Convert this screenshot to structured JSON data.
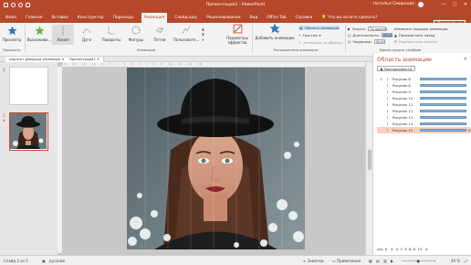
{
  "title_bar": {
    "title": "Презентация1 - PowerPoint",
    "user": "Наталья Смирнова",
    "win_min": "—",
    "win_max": "□",
    "win_close": "✕"
  },
  "menu": {
    "tabs": [
      "Файл",
      "Главная",
      "Вставка",
      "Конструктор",
      "Переходы",
      "Анимация",
      "Слайд-шоу",
      "Рецензирование",
      "Вид",
      "Office Tab",
      "Справка"
    ],
    "active": "Анимация",
    "tell_me": "Что вы хотите сделать?",
    "share": "Поделиться"
  },
  "ribbon": {
    "preview": "Просмотр",
    "effects": [
      "Выскакива...",
      "Линия",
      "Дуги",
      "Повороты",
      "Фигуры",
      "Петли",
      "Пользовате..."
    ],
    "effect_params": "Параметры эффектов",
    "add_animation": "Добавить анимацию",
    "anim_pane": "Область анимации",
    "trigger": "Триггер",
    "anim_painter": "Анимация по образцу",
    "start_label": "Запуск:",
    "start_value": "По щелчку",
    "duration_label": "Длительность:",
    "duration_value": "02,00",
    "delay_label": "Задержка:",
    "delay_value": "00,00",
    "reorder": "Изменить порядок анимации",
    "move_earlier": "Переместить назад",
    "move_later": "Переместить вперед",
    "group_preview": "Просмотр",
    "group_animation": "Анимация",
    "group_advanced": "Расширенная анимация",
    "group_timing": "Время показа слайдов"
  },
  "docbar": {
    "tab1": "портрет девушки анимация",
    "tab2": "Презентация1"
  },
  "slides": {
    "slide1": "1",
    "slide2": "2"
  },
  "ruler_marks": "16 · 14 · 12 · 10 · 8 · 6 · 4 · 2 · 0 · 2 · 4 · 6 · 8 · 10 · 12 · 14 · 16",
  "animation_pane": {
    "title": "Область анимации",
    "close": "✕",
    "play_button": "Воспроизвести",
    "items": [
      {
        "num": "1",
        "label": "Рисунок 6",
        "bar": 0.88
      },
      {
        "num": "",
        "label": "Рисунок 8",
        "bar": 0.88
      },
      {
        "num": "",
        "label": "Рисунок 9",
        "bar": 0.88
      },
      {
        "num": "",
        "label": "Рисунок 10",
        "bar": 0.88
      },
      {
        "num": "",
        "label": "Рисунок 11",
        "bar": 0.88
      },
      {
        "num": "",
        "label": "Рисунок 12",
        "bar": 0.88
      },
      {
        "num": "",
        "label": "Рисунок 13",
        "bar": 0.88
      },
      {
        "num": "",
        "label": "Рисунок 14",
        "bar": 0.88
      },
      {
        "num": "",
        "label": "Рисунок 15",
        "bar": 0.88
      }
    ],
    "selected_index": 8,
    "seconds": "сек.",
    "timeline": "0  2  4  6  8  10"
  },
  "status": {
    "slide": "Слайд 2 из 2",
    "lang": "русский",
    "notes": "Заметки",
    "comments": "Примечания",
    "zoom": "49 %"
  },
  "colors": {
    "accent": "#b7472a",
    "bar": "#8bb1d5",
    "selected_row": "#fbd0bd"
  }
}
